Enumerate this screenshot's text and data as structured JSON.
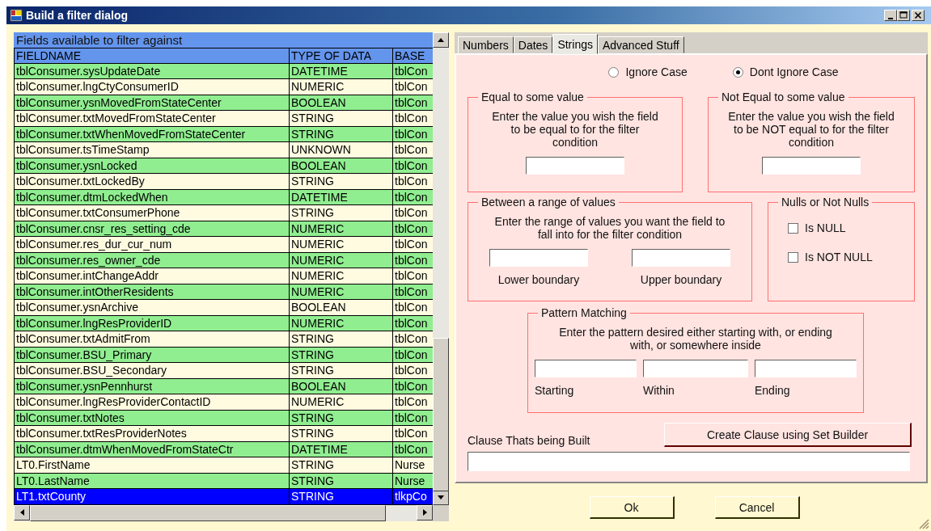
{
  "window": {
    "title": "Build a filter dialog"
  },
  "grid": {
    "caption": "Fields available to filter against",
    "columns": [
      "FIELDNAME",
      "TYPE OF DATA",
      "BASE"
    ],
    "rows": [
      {
        "cells": [
          "tblConsumer.sysUpdateDate",
          "DATETIME",
          "tblCon"
        ],
        "selected": false
      },
      {
        "cells": [
          "tblConsumer.lngCtyConsumerID",
          "NUMERIC",
          "tblCon"
        ],
        "selected": false
      },
      {
        "cells": [
          "tblConsumer.ysnMovedFromStateCenter",
          "BOOLEAN",
          "tblCon"
        ],
        "selected": false
      },
      {
        "cells": [
          "tblConsumer.txtMovedFromStateCenter",
          "STRING",
          "tblCon"
        ],
        "selected": false
      },
      {
        "cells": [
          "tblConsumer.txtWhenMovedFromStateCenter",
          "STRING",
          "tblCon"
        ],
        "selected": false
      },
      {
        "cells": [
          "tblConsumer.tsTimeStamp",
          "UNKNOWN",
          "tblCon"
        ],
        "selected": false
      },
      {
        "cells": [
          "tblConsumer.ysnLocked",
          "BOOLEAN",
          "tblCon"
        ],
        "selected": false
      },
      {
        "cells": [
          "tblConsumer.txtLockedBy",
          "STRING",
          "tblCon"
        ],
        "selected": false
      },
      {
        "cells": [
          "tblConsumer.dtmLockedWhen",
          "DATETIME",
          "tblCon"
        ],
        "selected": false
      },
      {
        "cells": [
          "tblConsumer.txtConsumerPhone",
          "STRING",
          "tblCon"
        ],
        "selected": false
      },
      {
        "cells": [
          "tblConsumer.cnsr_res_setting_cde",
          "NUMERIC",
          "tblCon"
        ],
        "selected": false
      },
      {
        "cells": [
          "tblConsumer.res_dur_cur_num",
          "NUMERIC",
          "tblCon"
        ],
        "selected": false
      },
      {
        "cells": [
          "tblConsumer.res_owner_cde",
          "NUMERIC",
          "tblCon"
        ],
        "selected": false
      },
      {
        "cells": [
          "tblConsumer.intChangeAddr",
          "NUMERIC",
          "tblCon"
        ],
        "selected": false
      },
      {
        "cells": [
          "tblConsumer.intOtherResidents",
          "NUMERIC",
          "tblCon"
        ],
        "selected": false
      },
      {
        "cells": [
          "tblConsumer.ysnArchive",
          "BOOLEAN",
          "tblCon"
        ],
        "selected": false
      },
      {
        "cells": [
          "tblConsumer.lngResProviderID",
          "NUMERIC",
          "tblCon"
        ],
        "selected": false
      },
      {
        "cells": [
          "tblConsumer.txtAdmitFrom",
          "STRING",
          "tblCon"
        ],
        "selected": false
      },
      {
        "cells": [
          "tblConsumer.BSU_Primary",
          "STRING",
          "tblCon"
        ],
        "selected": false
      },
      {
        "cells": [
          "tblConsumer.BSU_Secondary",
          "STRING",
          "tblCon"
        ],
        "selected": false
      },
      {
        "cells": [
          "tblConsumer.ysnPennhurst",
          "BOOLEAN",
          "tblCon"
        ],
        "selected": false
      },
      {
        "cells": [
          "tblConsumer.lngResProviderContactID",
          "NUMERIC",
          "tblCon"
        ],
        "selected": false
      },
      {
        "cells": [
          "tblConsumer.txtNotes",
          "STRING",
          "tblCon"
        ],
        "selected": false
      },
      {
        "cells": [
          "tblConsumer.txtResProviderNotes",
          "STRING",
          "tblCon"
        ],
        "selected": false
      },
      {
        "cells": [
          "tblConsumer.dtmWhenMovedFromStateCtr",
          "DATETIME",
          "tblCon"
        ],
        "selected": false
      },
      {
        "cells": [
          "LT0.FirstName",
          "STRING",
          "Nurse"
        ],
        "selected": false
      },
      {
        "cells": [
          "LT0.LastName",
          "STRING",
          "Nurse"
        ],
        "selected": false
      },
      {
        "cells": [
          "LT1.txtCounty",
          "STRING",
          "tlkpCo"
        ],
        "selected": true
      }
    ]
  },
  "tabs": [
    {
      "label": "Numbers",
      "selected": false
    },
    {
      "label": "Dates",
      "selected": false
    },
    {
      "label": "Strings",
      "selected": true
    },
    {
      "label": "Advanced Stuff",
      "selected": false
    }
  ],
  "case_options": [
    {
      "label": "Ignore Case",
      "selected": false
    },
    {
      "label": "Dont Ignore Case",
      "selected": true
    }
  ],
  "equal": {
    "title": "Equal to some value",
    "instructions": "Enter the value you wish the field to be equal to for the filter condition"
  },
  "not_equal": {
    "title": "Not Equal to some value",
    "instructions": "Enter the value you wish the field to be NOT equal to for the filter condition"
  },
  "range": {
    "title": "Between a range of values",
    "instructions": "Enter the range of values you want the field to fall into for the filter condition",
    "fields": [
      {
        "label": "Lower boundary"
      },
      {
        "label": "Upper boundary"
      }
    ]
  },
  "nulls": {
    "title": "Nulls or Not Nulls",
    "options": [
      {
        "label": "Is NULL",
        "checked": false
      },
      {
        "label": "Is NOT NULL",
        "checked": false
      }
    ]
  },
  "pattern": {
    "title": "Pattern Matching",
    "instructions": "Enter the pattern desired either starting with, or ending with, or somewhere inside",
    "fields": [
      {
        "label": "Starting"
      },
      {
        "label": "Within"
      },
      {
        "label": "Ending"
      }
    ]
  },
  "clause": {
    "label": "Clause Thats being Built",
    "button": "Create Clause using Set Builder"
  },
  "buttons": [
    "Ok",
    "Cancel"
  ]
}
